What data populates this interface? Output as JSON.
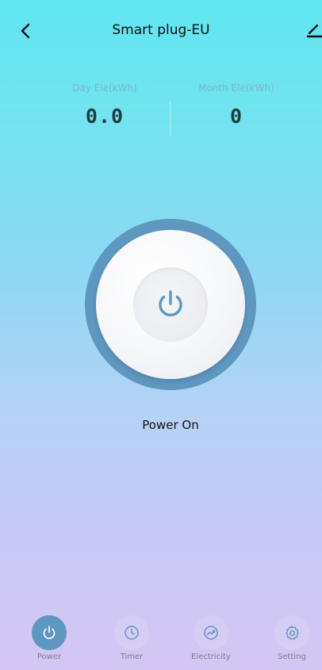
{
  "header": {
    "title": "Smart plug-EU",
    "back_icon": "chevron-left-icon",
    "edit_icon": "edit-icon"
  },
  "stats": {
    "day": {
      "label": "Day Ele(kWh)",
      "value": "0.0"
    },
    "month": {
      "label": "Month Ele(kWh)",
      "value": "0"
    }
  },
  "power": {
    "status": "Power On",
    "icon": "power-icon",
    "accent_color": "#5e97bf"
  },
  "tabs": [
    {
      "label": "Power",
      "icon": "power-icon",
      "active": true
    },
    {
      "label": "Timer",
      "icon": "clock-icon",
      "active": false
    },
    {
      "label": "Electricity",
      "icon": "trend-chart-icon",
      "active": false
    },
    {
      "label": "Setting",
      "icon": "gear-icon",
      "active": false
    }
  ]
}
